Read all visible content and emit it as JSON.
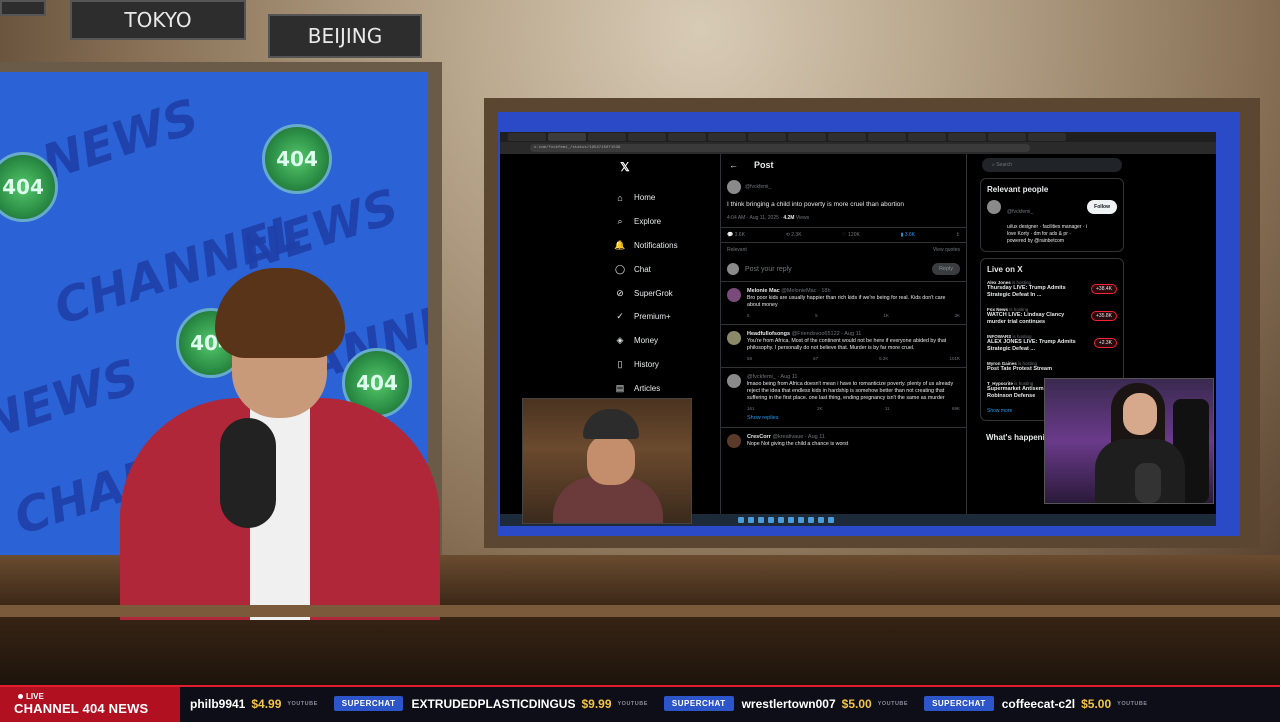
{
  "studio": {
    "city_signs": [
      "TOKYO",
      "BEIJING"
    ],
    "left_screen_text": [
      "CHANNEL",
      "NEWS",
      "404"
    ]
  },
  "browser": {
    "url": "x.com/fvckfemi_/status/1954715071536"
  },
  "x_app": {
    "nav": [
      {
        "label": "Home",
        "icon": "home-icon"
      },
      {
        "label": "Explore",
        "icon": "search-icon"
      },
      {
        "label": "Notifications",
        "icon": "bell-icon"
      },
      {
        "label": "Chat",
        "icon": "chat-icon"
      },
      {
        "label": "SuperGrok",
        "icon": "grok-icon"
      },
      {
        "label": "Premium+",
        "icon": "premium-icon"
      },
      {
        "label": "Money",
        "icon": "money-icon"
      },
      {
        "label": "History",
        "icon": "history-icon"
      },
      {
        "label": "Articles",
        "icon": "articles-icon"
      }
    ],
    "post_header": "Post",
    "post": {
      "handle": "@fvckfemi_",
      "text": "I think bringing a child into poverty is more cruel than abortion",
      "time": "4:04 AM · Aug 11, 2025 ·",
      "views": "4.2M",
      "views_label": "Views",
      "replies": "3.6K",
      "reposts": "2.3K",
      "likes": "120K",
      "bookmarks": "3.6K",
      "sort": "Relevant",
      "view_quotes": "View quotes"
    },
    "reply_placeholder": "Post your reply",
    "reply_button": "Reply",
    "replies": [
      {
        "name": "Melonie Mac",
        "meta": "@MelonieMac · 18h",
        "text": "Bro poor kids are usually happier than rich kids if we're being for real. Kids don't care about money",
        "stats": [
          "5",
          "5",
          "1K",
          "3K"
        ]
      },
      {
        "name": "Headfullofsongs",
        "meta": "@Friendsvoo65122 · Aug 11",
        "text": "You're from Africa.  Most of the continent would not be here if everyone abided by that philosophy.  I personally do not believe that.  Murder is by far more cruel.",
        "stats": [
          "58",
          "67",
          "5.2K",
          "101K"
        ]
      },
      {
        "name": "",
        "meta": "@fvckfemi_ · Aug 11",
        "text": "lmaoo being from Africa doesn't mean i have to romanticize poverty. plenty of us already reject the idea that endless kids in hardship is somehow better than not creating that suffering in the first place. one last thing, ending pregnancy isn't the same as murder",
        "stats": [
          "161",
          "2K",
          "11",
          "69K"
        ],
        "show_replies": "Show replies"
      },
      {
        "name": "CresCorr",
        "meta": "@kreativaue · Aug 11",
        "text": "Nope Not giving the child a chance is worst",
        "stats": []
      }
    ],
    "search_placeholder": "Search",
    "relevant_people": {
      "title": "Relevant people",
      "handle": "@fvckfemi_",
      "follow": "Follow",
      "bio": "ui/ux designer · facilities manager · i love Korty · dm for ads & pr · powered by @rainbetcom"
    },
    "live": {
      "title": "Live on X",
      "items": [
        {
          "host": "Alex Jones",
          "status": "is hosting",
          "title": "Thursday LIVE: Trump Admits Strategic Defeat In ...",
          "count": "+38.4K"
        },
        {
          "host": "Fox News",
          "status": "is hosting",
          "title": "WATCH LIVE: Lindsay Clancy murder trial continues",
          "count": "+35.8K"
        },
        {
          "host": "INFOWARS",
          "status": "is hosting",
          "title": "ALEX JONES LIVE: Trump Admits Strategic Defeat ...",
          "count": "+2.3K"
        },
        {
          "host": "Myron Gaines",
          "status": "is hosting",
          "title": "Post Tate Protest Stream",
          "count": ""
        },
        {
          "host": "T_Hypocrite",
          "status": "is hosting",
          "title": "Supermarket Antisemitism; Tyler Robinson Defense",
          "count": ""
        }
      ],
      "show_more": "Show more"
    },
    "whats_happening": "What's happening"
  },
  "ticker": {
    "live_label": "LIVE",
    "channel": "CHANNEL 404 NEWS",
    "items": [
      {
        "badge": "",
        "name": "philb9941",
        "amount": "$4.99",
        "source": "YOUTUBE"
      },
      {
        "badge": "SUPERCHAT",
        "name": "EXTRUDEDPLASTICDINGUS",
        "amount": "$9.99",
        "source": "YOUTUBE"
      },
      {
        "badge": "SUPERCHAT",
        "name": "wrestlertown007",
        "amount": "$5.00",
        "source": "YOUTUBE"
      },
      {
        "badge": "SUPERCHAT",
        "name": "coffeecat-c2l",
        "amount": "$5.00",
        "source": "YOUTUBE"
      }
    ]
  },
  "colors": {
    "ticker_red": "#e11d2e",
    "superchat_blue": "#2b55c8",
    "amount_yellow": "#f4c542",
    "x_link_blue": "#1d9bf0"
  }
}
